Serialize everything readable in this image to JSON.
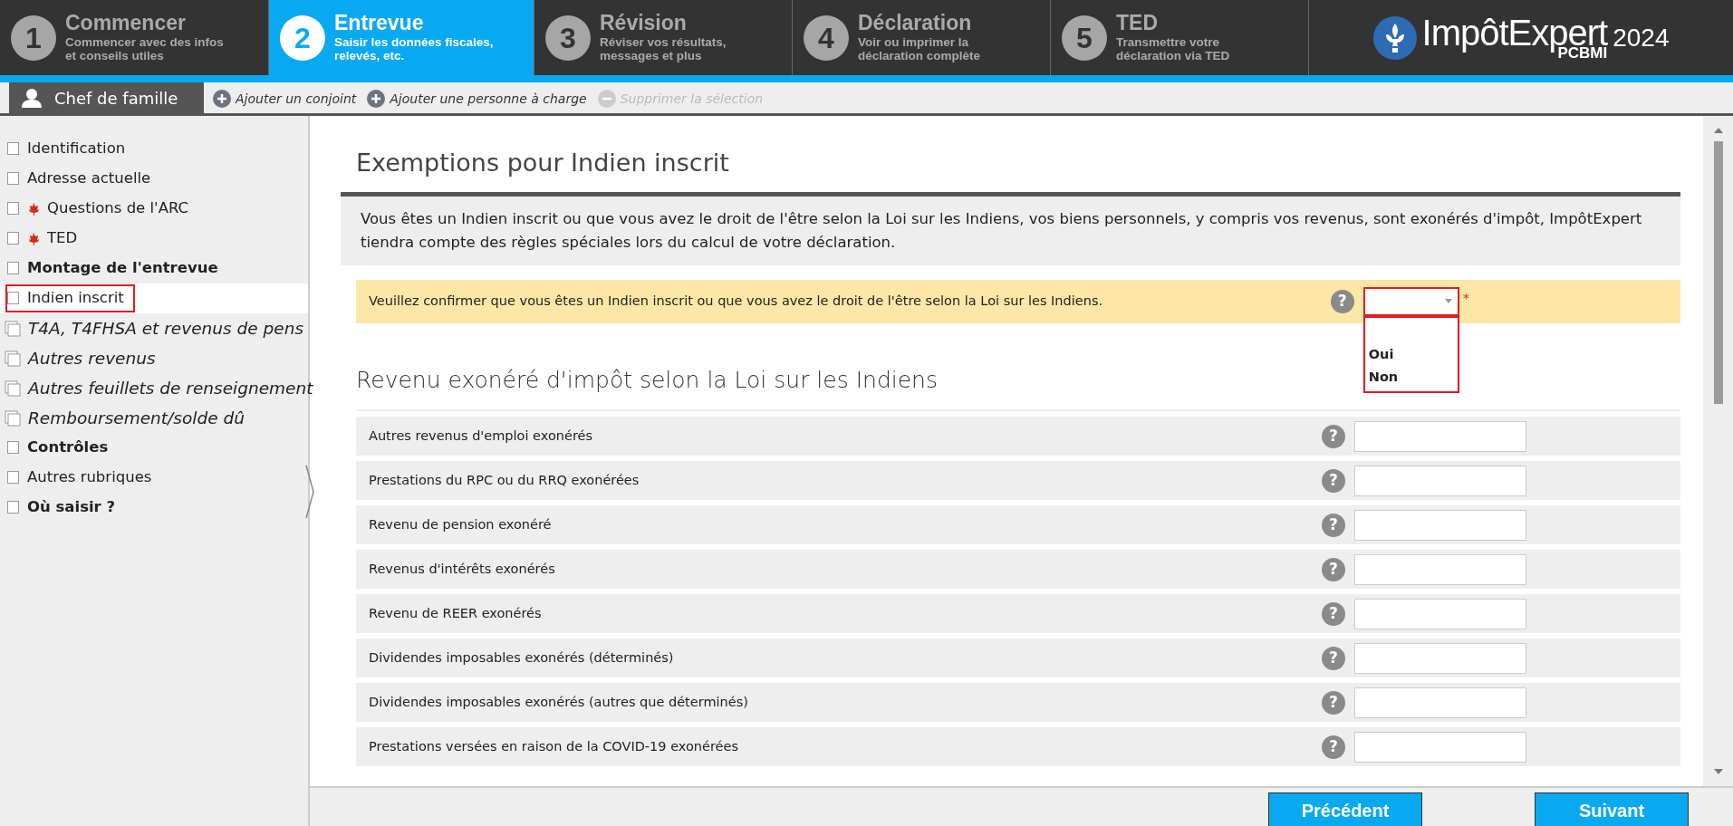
{
  "steps": [
    {
      "number": "1",
      "title": "Commencer",
      "subtitle": "Commencer avec des infos\net conseils utiles",
      "selected": false
    },
    {
      "number": "2",
      "title": "Entrevue",
      "subtitle": "Saisir les données fiscales,\nrelevés, etc.",
      "selected": true
    },
    {
      "number": "3",
      "title": "Révision",
      "subtitle": "Réviser vos résultats,\nmessages et plus",
      "selected": false
    },
    {
      "number": "4",
      "title": "Déclaration",
      "subtitle": "Voir ou imprimer la\ndéclaration complète",
      "selected": false
    },
    {
      "number": "5",
      "title": "TED",
      "subtitle": "Transmettre votre\ndéclaration via TED",
      "selected": false
    }
  ],
  "logo": {
    "name": "ImpôtExpert",
    "edition": "PCBMI",
    "year": "2024"
  },
  "person_bar": {
    "current": "Chef de famille",
    "actions": [
      {
        "label": "Ajouter un conjoint",
        "kind": "add",
        "disabled": false
      },
      {
        "label": "Ajouter une personne à charge",
        "kind": "add",
        "disabled": false
      },
      {
        "label": "Supprimer la sélection",
        "kind": "remove",
        "disabled": true
      }
    ]
  },
  "sidebar": {
    "items": [
      {
        "label": "Identification",
        "kind": "page",
        "selected": false
      },
      {
        "label": "Adresse actuelle",
        "kind": "page",
        "selected": false
      },
      {
        "label": "Questions de l'ARC",
        "kind": "federal-page",
        "selected": false
      },
      {
        "label": "TED",
        "kind": "federal-page",
        "selected": false
      },
      {
        "label": "Montage de l'entrevue",
        "kind": "section",
        "selected": false
      },
      {
        "label": "Indien inscrit",
        "kind": "page",
        "selected": true
      },
      {
        "label": "T4A, T4FHSA et revenus de pens",
        "kind": "group",
        "selected": false
      },
      {
        "label": "Autres revenus",
        "kind": "group",
        "selected": false
      },
      {
        "label": "Autres feuillets de renseignement",
        "kind": "group",
        "selected": false
      },
      {
        "label": "Remboursement/solde dû",
        "kind": "group",
        "selected": false
      },
      {
        "label": "Contrôles",
        "kind": "section",
        "selected": false
      },
      {
        "label": "Autres rubriques",
        "kind": "page",
        "selected": false
      },
      {
        "label": "Où saisir ?",
        "kind": "section",
        "selected": false
      }
    ]
  },
  "form": {
    "title": "Exemptions pour Indien inscrit",
    "intro": "Vous êtes un Indien inscrit ou que vous avez le droit de l'être selon la Loi sur les Indiens, vos biens personnels, y compris vos revenus, sont exonérés d'impôt, ImpôtExpert tiendra compte des règles spéciales lors du calcul de votre déclaration.",
    "question": {
      "text": "Veuillez confirmer que vous êtes un Indien inscrit ou que vous avez le droit de l'être selon la Loi sur les Indiens.",
      "help": "?",
      "required_mark": "*",
      "dropdown": {
        "expanded": true,
        "options": [
          {
            "label": "Oui"
          },
          {
            "label": "Non"
          }
        ]
      }
    },
    "section_title": "Revenu exonéré d'impôt selon la Loi sur les Indiens",
    "fields": [
      {
        "label": "Autres revenus d'emploi exonérés",
        "help": "?"
      },
      {
        "label": "Prestations du RPC ou du RRQ exonérées",
        "help": "?"
      },
      {
        "label": "Revenu de pension exonéré",
        "help": "?"
      },
      {
        "label": "Revenus d'intérêts exonérés",
        "help": "?"
      },
      {
        "label": "Revenu de REER exonérés",
        "help": "?"
      },
      {
        "label": "Dividendes imposables exonérés (déterminés)",
        "help": "?"
      },
      {
        "label": "Dividendes imposables exonérés (autres que déterminés)",
        "help": "?"
      },
      {
        "label": "Prestations versées en raison de la COVID-19 exonérées",
        "help": "?"
      }
    ]
  },
  "buttons": [
    {
      "label": "Précédent"
    },
    {
      "label": "Suivant"
    }
  ]
}
